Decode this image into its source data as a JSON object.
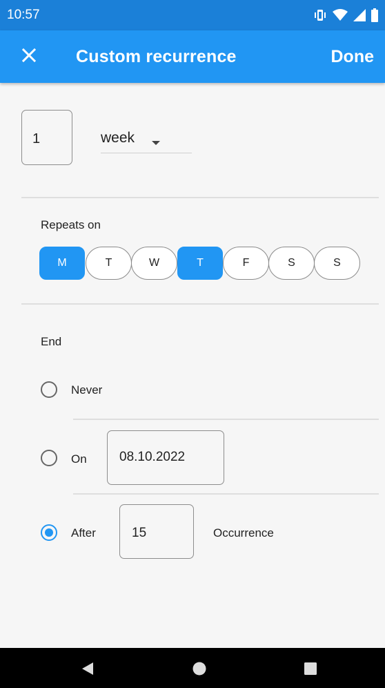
{
  "status_bar": {
    "time": "10:57",
    "icons": [
      "vibrate-icon",
      "wifi-icon",
      "signal-icon",
      "battery-icon"
    ]
  },
  "app_bar": {
    "close_icon": "close-icon",
    "title": "Custom recurrence",
    "done_label": "Done"
  },
  "interval": {
    "value": "1",
    "unit": "week"
  },
  "repeats": {
    "label": "Repeats on",
    "days": [
      {
        "label": "M",
        "selected": true
      },
      {
        "label": "T",
        "selected": false
      },
      {
        "label": "W",
        "selected": false
      },
      {
        "label": "T",
        "selected": true
      },
      {
        "label": "F",
        "selected": false
      },
      {
        "label": "S",
        "selected": false
      },
      {
        "label": "S",
        "selected": false
      }
    ]
  },
  "end": {
    "label": "End",
    "options": {
      "never": {
        "label": "Never",
        "checked": false
      },
      "on": {
        "label": "On",
        "date": "08.10.2022",
        "checked": false
      },
      "after": {
        "label": "After",
        "count": "15",
        "suffix": "Occurrence",
        "checked": true
      }
    }
  },
  "colors": {
    "primary": "#2196f3",
    "status_bar": "#1b80d8",
    "background": "#f6f6f6"
  }
}
